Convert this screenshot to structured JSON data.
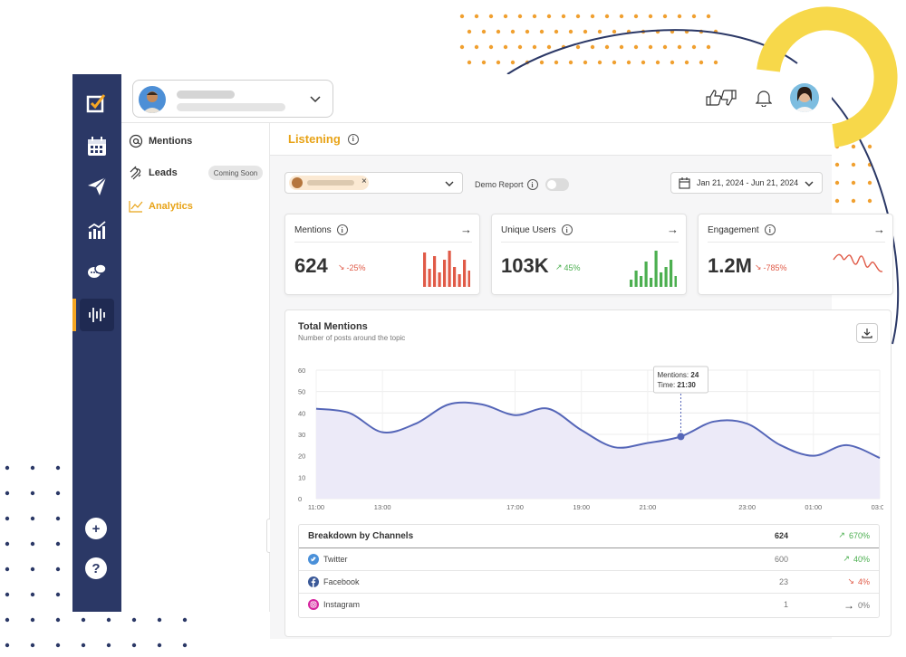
{
  "header": {
    "reaction_icon": "thumbs-up-down-icon",
    "notification_icon": "bell-icon"
  },
  "subnav": {
    "items": [
      {
        "label": "Mentions",
        "icon": "at-icon"
      },
      {
        "label": "Leads",
        "icon": "magnet-icon",
        "badge": "Coming Soon"
      },
      {
        "label": "Analytics",
        "icon": "chart-line-icon",
        "active": true
      }
    ]
  },
  "page": {
    "title": "Listening",
    "demo_label": "Demo Report",
    "date_range": "Jan 21, 2024 - Jun 21, 2024"
  },
  "kpis": [
    {
      "label": "Mentions",
      "value": "624",
      "change": "-25%",
      "trend": "down",
      "color": "#e05a47"
    },
    {
      "label": "Unique Users",
      "value": "103K",
      "change": "45%",
      "trend": "up",
      "color": "#4caf50"
    },
    {
      "label": "Engagement",
      "value": "1.2M",
      "change": "-785%",
      "trend": "down",
      "color": "#e05a47"
    }
  ],
  "total_mentions": {
    "title": "Total Mentions",
    "subtitle": "Number of posts around the topic",
    "tooltip": {
      "mentions_label": "Mentions:",
      "mentions_value": "24",
      "time_label": "Time:",
      "time_value": "21:30"
    }
  },
  "chart_data": {
    "type": "area",
    "title": "Total Mentions",
    "x": [
      "11:00",
      "12:00",
      "13:00",
      "14:00",
      "15:00",
      "16:00",
      "17:00",
      "18:00",
      "19:00",
      "20:00",
      "21:00",
      "21:30",
      "22:00",
      "23:00",
      "00:00",
      "01:00",
      "02:00",
      "03:00"
    ],
    "y": [
      42,
      40,
      31,
      35,
      44,
      44,
      39,
      42,
      32,
      24,
      26,
      29,
      36,
      35,
      25,
      20,
      25,
      19
    ],
    "ylim": [
      0,
      60
    ],
    "yticks": [
      0,
      10,
      20,
      30,
      40,
      50,
      60
    ],
    "xticks": [
      "11:00",
      "13:00",
      "17:00",
      "19:00",
      "21:00",
      "23:00",
      "01:00",
      "03:00"
    ],
    "highlight": {
      "x": "21:30",
      "y": 29
    },
    "grid": true,
    "line_color": "#5566b8",
    "fill_color": "#eceaf8"
  },
  "breakdown": {
    "title": "Breakdown by Channels",
    "total": "624",
    "total_change": "670%",
    "rows": [
      {
        "name": "Twitter",
        "icon": "twitter-icon",
        "count": "600",
        "change": "40%",
        "trend": "up"
      },
      {
        "name": "Facebook",
        "icon": "facebook-icon",
        "count": "23",
        "change": "4%",
        "trend": "down"
      },
      {
        "name": "Instagram",
        "icon": "instagram-icon",
        "count": "1",
        "change": "0%",
        "trend": "flat"
      }
    ]
  },
  "colors": {
    "rail": "#2b3866",
    "accent": "#e8a317",
    "positive": "#4caf50",
    "negative": "#e05a47"
  }
}
